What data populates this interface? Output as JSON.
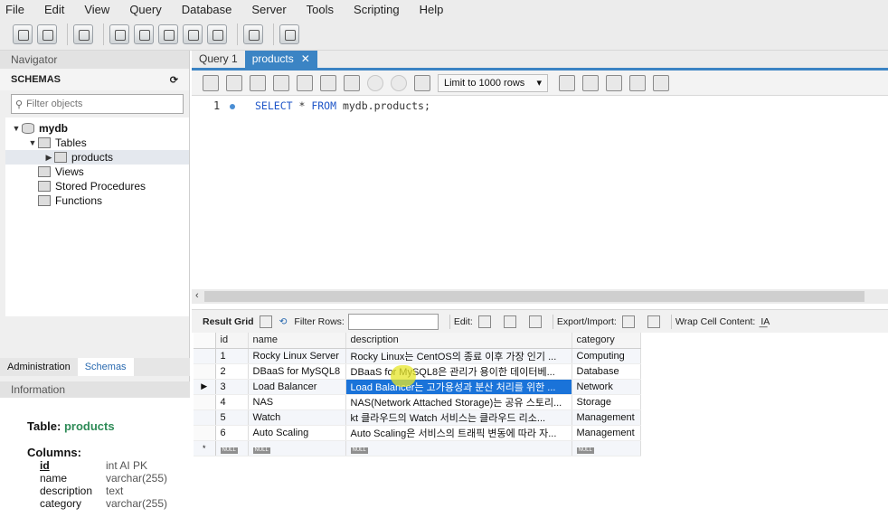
{
  "menu": [
    "File",
    "Edit",
    "View",
    "Query",
    "Database",
    "Server",
    "Tools",
    "Scripting",
    "Help"
  ],
  "navigator": {
    "title": "Navigator",
    "schemas_label": "SCHEMAS",
    "filter_placeholder": "Filter objects",
    "tree": [
      {
        "label": "mydb",
        "level": 0,
        "arrow": "▼",
        "bold": true
      },
      {
        "label": "Tables",
        "level": 1,
        "arrow": "▼"
      },
      {
        "label": "products",
        "level": 2,
        "arrow": "▶"
      },
      {
        "label": "Views",
        "level": 1,
        "arrow": ""
      },
      {
        "label": "Stored Procedures",
        "level": 1,
        "arrow": ""
      },
      {
        "label": "Functions",
        "level": 1,
        "arrow": ""
      }
    ]
  },
  "bottom_tabs": {
    "admin": "Administration",
    "schemas": "Schemas"
  },
  "info": {
    "header": "Information",
    "table_prefix": "Table:",
    "table_name": "products",
    "columns_label": "Columns:",
    "columns": [
      {
        "name": "id",
        "type": "int AI PK"
      },
      {
        "name": "name",
        "type": "varchar(255)"
      },
      {
        "name": "description",
        "type": "text"
      },
      {
        "name": "category",
        "type": "varchar(255)"
      }
    ]
  },
  "tabs": {
    "query1": "Query 1",
    "products": "products"
  },
  "query_toolbar": {
    "limit": "Limit to 1000 rows"
  },
  "editor": {
    "line": "1",
    "sql_kw1": "SELECT",
    "sql_mid": " * ",
    "sql_kw2": "FROM",
    "sql_rest": " mydb.products;"
  },
  "result_toolbar": {
    "result_grid": "Result Grid",
    "filter_rows": "Filter Rows:",
    "edit": "Edit:",
    "export": "Export/Import:",
    "wrap": "Wrap Cell Content:"
  },
  "grid": {
    "headers": [
      "id",
      "name",
      "description",
      "category"
    ],
    "rows": [
      [
        "1",
        "Rocky Linux Server",
        "Rocky Linux는 CentOS의 종료 이후 가장 인기 ...",
        "Computing"
      ],
      [
        "2",
        "DBaaS for MySQL8",
        "DBaaS for MySQL8은 관리가 용이한 데이터베...",
        "Database"
      ],
      [
        "3",
        "Load Balancer",
        "Load Balancer는 고가용성과 분산 처리를 위한 ...",
        "Network"
      ],
      [
        "4",
        "NAS",
        "NAS(Network Attached Storage)는 공유 스토리...",
        "Storage"
      ],
      [
        "5",
        "Watch",
        "kt 클라우드의 Watch 서비스는 클라우드 리소...",
        "Management"
      ],
      [
        "6",
        "Auto Scaling",
        "Auto Scaling은 서비스의 트래픽 변동에 따라 자...",
        "Management"
      ]
    ],
    "null_label": "NULL"
  }
}
